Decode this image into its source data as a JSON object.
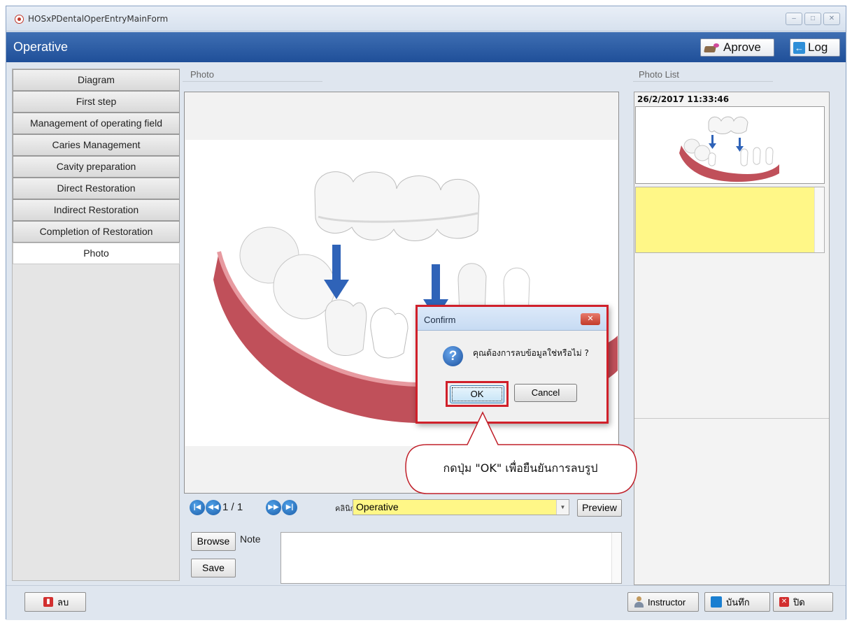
{
  "window": {
    "title": "HOSxPDentalOperEntryMainForm",
    "controls": [
      "minimize-icon",
      "maximize-icon",
      "close-icon"
    ]
  },
  "header": {
    "title": "Operative",
    "aprove_label": "Aprove",
    "log_label": "Log"
  },
  "sidebar": {
    "items": [
      {
        "label": "Diagram"
      },
      {
        "label": "First step"
      },
      {
        "label": "Management of operating field"
      },
      {
        "label": "Caries Management"
      },
      {
        "label": "Cavity preparation"
      },
      {
        "label": "Direct Restoration"
      },
      {
        "label": "Indirect Restoration"
      },
      {
        "label": "Completion of Restoration"
      },
      {
        "label": "Photo",
        "active": true
      }
    ]
  },
  "photo": {
    "section_label": "Photo",
    "pager": "1 / 1",
    "clinic_label": "คลินิก",
    "clinic_value": "Operative",
    "preview_label": "Preview",
    "browse_label": "Browse",
    "save_label": "Save",
    "note_label": "Note",
    "note_value": ""
  },
  "photo_list": {
    "section_label": "Photo List",
    "items": [
      {
        "datetime": "26/2/2017 11:33:46"
      }
    ]
  },
  "dialog": {
    "title": "Confirm",
    "message": "คุณต้องการลบข้อมูลใช่หรือไม่ ?",
    "ok_label": "OK",
    "cancel_label": "Cancel"
  },
  "callout": {
    "text": "กดปุ่ม \"OK\" เพื่อยืนยันการลบรูป"
  },
  "footer": {
    "delete_label": "ลบ",
    "instructor_label": "Instructor",
    "save_label": "บันทึก",
    "close_label": "ปิด"
  },
  "colors": {
    "header_blue": "#1f4f99",
    "highlight_yellow": "#fff787",
    "annotation_red": "#d0202a",
    "tooth_arrow_blue": "#2f63b8"
  }
}
